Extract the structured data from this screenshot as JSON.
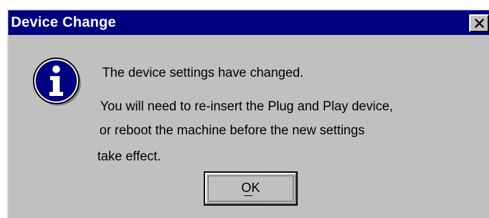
{
  "window": {
    "title": "Device Change",
    "close_glyph": "✕"
  },
  "icon": {
    "name": "information-icon",
    "glyph": "i",
    "color": "#000080"
  },
  "message": {
    "line1": "The device settings have changed.",
    "line2": "You will need to re-insert the Plug and Play device,",
    "line3": "or reboot the machine before the new settings",
    "line4": "take effect."
  },
  "buttons": {
    "ok_label": "OK"
  },
  "colors": {
    "titlebar": "#000080",
    "dialog_face": "#c0c0c0",
    "title_text": "#ffffff"
  }
}
